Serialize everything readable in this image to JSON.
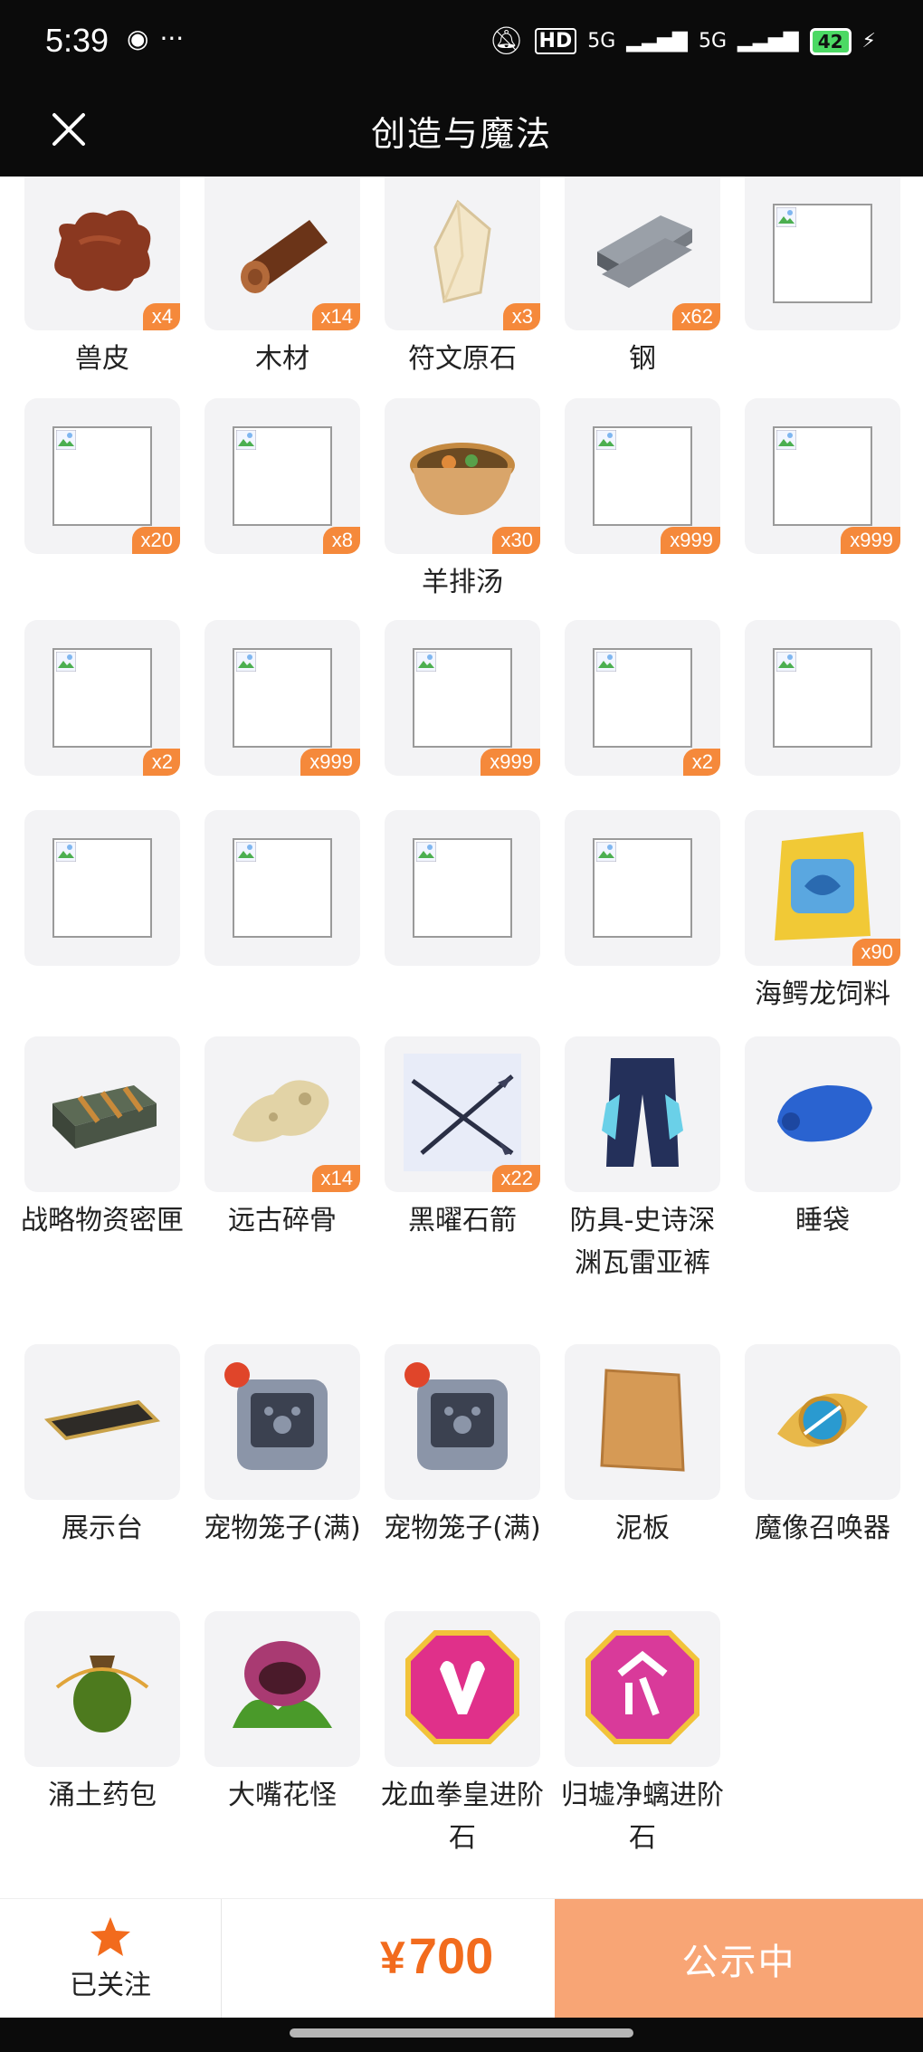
{
  "status": {
    "time": "5:39",
    "battery": "42",
    "network": "5G",
    "hd": "HD"
  },
  "nav": {
    "title": "创造与魔法"
  },
  "items": [
    {
      "name": "兽皮",
      "count": "x4",
      "icon": "hide"
    },
    {
      "name": "木材",
      "count": "x14",
      "icon": "log"
    },
    {
      "name": "符文原石",
      "count": "x3",
      "icon": "crystal"
    },
    {
      "name": "钢",
      "count": "x62",
      "icon": "steel"
    },
    {
      "name": "",
      "count": "",
      "icon": "broken"
    },
    {
      "name": "",
      "count": "x20",
      "icon": "broken"
    },
    {
      "name": "",
      "count": "x8",
      "icon": "broken"
    },
    {
      "name": "羊排汤",
      "count": "x30",
      "icon": "soup"
    },
    {
      "name": "",
      "count": "x999",
      "icon": "broken"
    },
    {
      "name": "",
      "count": "x999",
      "icon": "broken"
    },
    {
      "name": "",
      "count": "x2",
      "icon": "broken"
    },
    {
      "name": "",
      "count": "x999",
      "icon": "broken"
    },
    {
      "name": "",
      "count": "x999",
      "icon": "broken"
    },
    {
      "name": "",
      "count": "x2",
      "icon": "broken"
    },
    {
      "name": "",
      "count": "",
      "icon": "broken"
    },
    {
      "name": "",
      "count": "",
      "icon": "broken"
    },
    {
      "name": "",
      "count": "",
      "icon": "broken"
    },
    {
      "name": "",
      "count": "",
      "icon": "broken"
    },
    {
      "name": "",
      "count": "",
      "icon": "broken"
    },
    {
      "name": "海鳄龙饲料",
      "count": "x90",
      "icon": "feed-bag"
    },
    {
      "name": "战略物资密匣",
      "count": "",
      "icon": "supply-box"
    },
    {
      "name": "远古碎骨",
      "count": "x14",
      "icon": "bone"
    },
    {
      "name": "黑曜石箭",
      "count": "x22",
      "icon": "arrows"
    },
    {
      "name": "防具-史诗深渊瓦雷亚裤",
      "count": "",
      "icon": "pants"
    },
    {
      "name": "睡袋",
      "count": "",
      "icon": "sleeping-bag"
    },
    {
      "name": "展示台",
      "count": "",
      "icon": "display-stand"
    },
    {
      "name": "宠物笼子(满)",
      "count": "",
      "icon": "pet-cage"
    },
    {
      "name": "宠物笼子(满)",
      "count": "",
      "icon": "pet-cage"
    },
    {
      "name": "泥板",
      "count": "",
      "icon": "clay-tablet"
    },
    {
      "name": "魔像召唤器",
      "count": "",
      "icon": "golem-summoner"
    },
    {
      "name": "涌土药包",
      "count": "",
      "icon": "potion-bag"
    },
    {
      "name": "大嘴花怪",
      "count": "",
      "icon": "flower-monster"
    },
    {
      "name": "龙血拳皇进阶石",
      "count": "",
      "icon": "gem-bull"
    },
    {
      "name": "归墟净螭进阶石",
      "count": "",
      "icon": "gem-rune"
    }
  ],
  "footer": {
    "follow_label": "已关注",
    "price_symbol": "¥",
    "price": "700",
    "cta_label": "公示中"
  },
  "colors": {
    "accent": "#f26b1d",
    "badge": "#f5893b",
    "cta": "#f8a575"
  }
}
